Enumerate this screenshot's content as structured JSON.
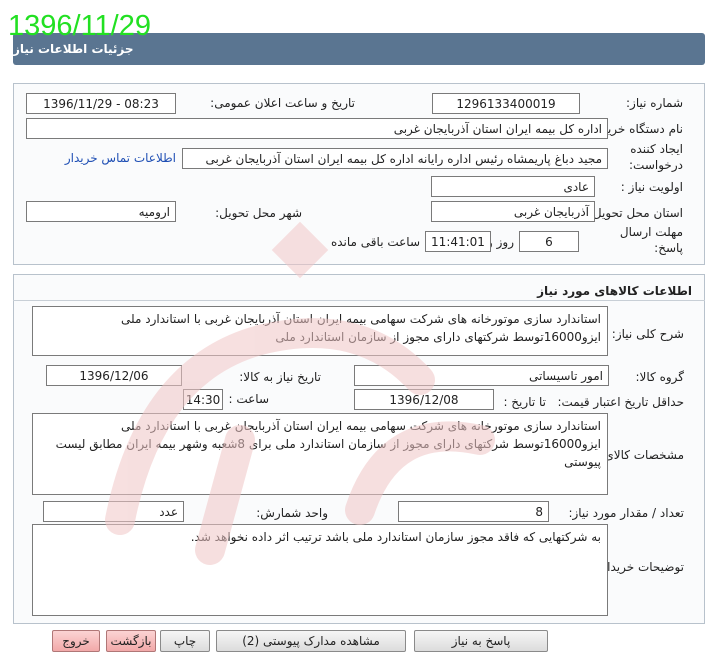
{
  "stamp_date": "1396/11/29",
  "header": {
    "title": "جزئیات اطلاعات نیاز"
  },
  "general": {
    "need_number_label": "شماره نیاز:",
    "need_number": "1296133400019",
    "announce_label": "تاریخ و ساعت اعلان عمومی:",
    "announce_value": "1396/11/29 - 08:23",
    "buyer_org_label": "نام دستگاه خریدار:",
    "buyer_org": "اداره کل بیمه ایران استان آذربایجان غربی",
    "creator_label_1": "ایجاد کننده",
    "creator_label_2": "درخواست:",
    "creator": "مجید دباغ پاریمشاه رئیس اداره رایانه  اداره کل بیمه ایران استان آذربایجان غربی",
    "contact_link": "اطلاعات تماس خریدار",
    "priority_label": "اولویت نیاز :",
    "priority": "عادی",
    "province_label": "استان محل تحویل:",
    "province": "آذربایجان غربی",
    "city_label": "شهر محل تحویل:",
    "city": "ارومیه",
    "deadline_label_1": "مهلت ارسال",
    "deadline_label_2": "پاسخ:",
    "deadline_days": "6",
    "days_and": "روز و",
    "deadline_time": "11:41:01",
    "remaining": "ساعت باقی مانده"
  },
  "goods": {
    "section_title": "اطلاعات کالاهای مورد نیاز",
    "summary_label": "شرح کلی نیاز:",
    "summary": "استاندارد سازی موتورخانه های شرکت سهامی بیمه ایران استان آذربایجان غربی با استاندارد ملی ایزو16000توسط شرکتهای دارای مجوز از سازمان استاندارد ملی",
    "group_label": "گروه کالا:",
    "group": "امور تاسیساتی",
    "need_date_label": "تاریخ نیاز به کالا:",
    "need_date": "1396/12/06",
    "min_price_label": "حداقل تاریخ اعتبار قیمت:",
    "until_date_label": "تا تاریخ :",
    "until_date": "1396/12/08",
    "hour_label": "ساعت :",
    "hour": "14:30",
    "spec_label": "مشخصات کالای مورد نیاز:",
    "spec": "استاندارد سازی موتورخانه های شرکت سهامی بیمه ایران استان آذربایجان غربی با استاندارد ملی ایزو16000توسط شرکتهای دارای مجوز از سازمان استاندارد ملی برای 8شعبه وشهر بیمه ایران مطابق لیست پیوستی",
    "qty_label": "تعداد / مقدار مورد نیاز:",
    "qty": "8",
    "unit_label": "واحد شمارش:",
    "unit": "عدد",
    "buyer_notes_label": "توضیحات خریدار:",
    "buyer_notes": "به شرکتهایی که فاقد مجوز سازمان استاندارد ملی باشد ترتیب اثر داده نخواهد شد."
  },
  "buttons": {
    "reply": "پاسخ به نیاز",
    "view_docs": "مشاهده مدارک پیوستی (2)",
    "print": "چاپ",
    "back": "بازگشت",
    "exit": "خروج"
  },
  "watermark": {
    "text": "هزاره",
    "color": "#e8b0b0"
  }
}
